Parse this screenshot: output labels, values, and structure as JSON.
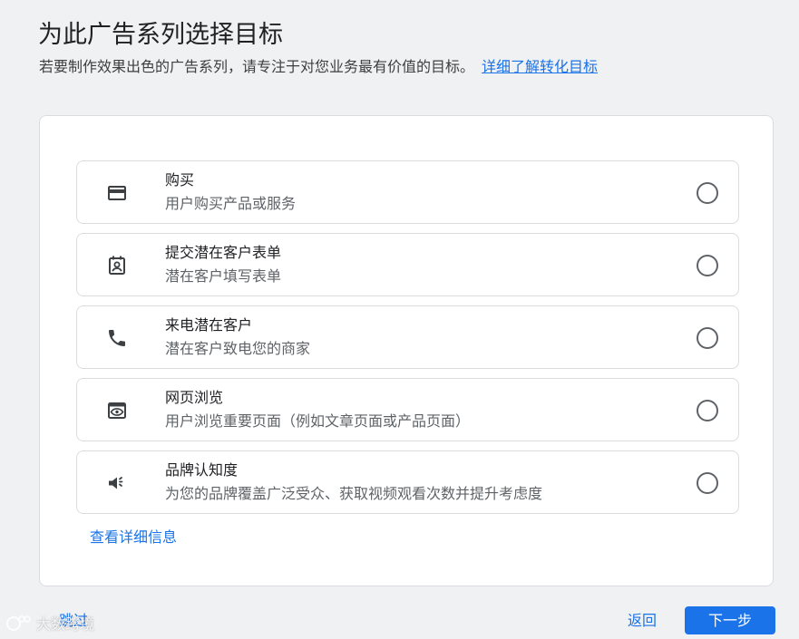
{
  "header": {
    "title": "为此广告系列选择目标",
    "subtitle": "若要制作效果出色的广告系列，请专注于对您业务最有价值的目标。",
    "learn_more_link": "详细了解转化目标"
  },
  "options": [
    {
      "icon": "credit-card-icon",
      "title": "购买",
      "description": "用户购买产品或服务",
      "selected": false
    },
    {
      "icon": "contact-form-icon",
      "title": "提交潜在客户表单",
      "description": "潜在客户填写表单",
      "selected": false
    },
    {
      "icon": "phone-icon",
      "title": "来电潜在客户",
      "description": "潜在客户致电您的商家",
      "selected": false
    },
    {
      "icon": "web-page-view-icon",
      "title": "网页浏览",
      "description": "用户浏览重要页面（例如文章页面或产品页面）",
      "selected": false
    },
    {
      "icon": "megaphone-icon",
      "title": "品牌认知度",
      "description": "为您的品牌覆盖广泛受众、获取视频观看次数并提升考虑度",
      "selected": false
    }
  ],
  "more_info_link": "查看详细信息",
  "footer": {
    "skip_label": "跳过",
    "back_label": "返回",
    "next_label": "下一步"
  },
  "watermark": {
    "text": "大数跨境"
  },
  "colors": {
    "accent": "#1a73e8",
    "background": "#f0f1f2",
    "card": "#ffffff",
    "border": "#dadce0"
  }
}
